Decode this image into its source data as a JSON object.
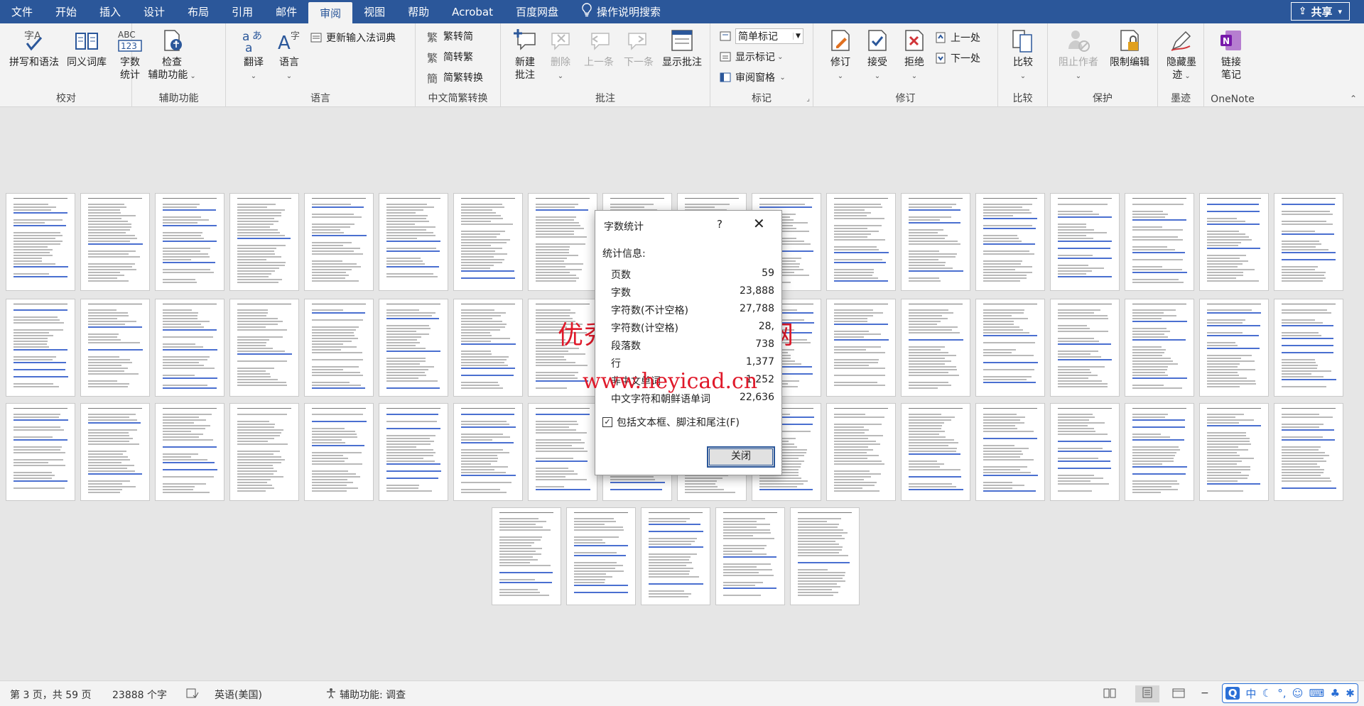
{
  "tabs": [
    "文件",
    "开始",
    "插入",
    "设计",
    "布局",
    "引用",
    "邮件",
    "审阅",
    "视图",
    "帮助",
    "Acrobat",
    "百度网盘"
  ],
  "active_tab": "审阅",
  "tell_me": "操作说明搜索",
  "share": "共享",
  "ribbon": {
    "proofing": {
      "label": "校对",
      "spelling": "拼写和语法",
      "thesaurus": "同义词库",
      "wordcount_line1": "字数",
      "wordcount_line2": "统计",
      "wordcount_icon_text": "ABC",
      "wordcount_icon_num": "123"
    },
    "accessibility": {
      "label": "辅助功能",
      "check_line1": "检查",
      "check_line2": "辅助功能"
    },
    "language": {
      "label": "语言",
      "translate": "翻译",
      "language": "语言",
      "update_ime": "更新输入法词典"
    },
    "chinese_conversion": {
      "label": "中文简繁转换",
      "to_simplified": "繁转简",
      "to_traditional": "简转繁",
      "convert": "简繁转换"
    },
    "comments": {
      "label": "批注",
      "new_line1": "新建",
      "new_line2": "批注",
      "delete": "删除",
      "previous": "上一条",
      "next": "下一条",
      "show": "显示批注"
    },
    "tracking": {
      "label": "标记",
      "markup_combo": "简单标记",
      "show_markup": "显示标记",
      "review_pane": "审阅窗格"
    },
    "changes": {
      "label": "修订",
      "track": "修订",
      "accept": "接受",
      "reject": "拒绝",
      "previous": "上一处",
      "next": "下一处"
    },
    "compare": {
      "label": "比较",
      "compare": "比较"
    },
    "protect": {
      "label": "保护",
      "block_authors": "阻止作者",
      "restrict": "限制编辑"
    },
    "ink": {
      "label": "墨迹",
      "hide_line1": "隐藏墨",
      "hide_line2": "迹"
    },
    "onenote": {
      "label": "OneNote",
      "linked_line1": "链接",
      "linked_line2": "笔记"
    }
  },
  "dialog": {
    "title": "字数统计",
    "help": "?",
    "close_x": "✕",
    "section": "统计信息:",
    "stats": [
      {
        "label": "页数",
        "value": "59"
      },
      {
        "label": "字数",
        "value": "23,888"
      },
      {
        "label": "字符数(不计空格)",
        "value": "27,788"
      },
      {
        "label": "字符数(计空格)",
        "value": "28,"
      },
      {
        "label": "段落数",
        "value": "738"
      },
      {
        "label": "行",
        "value": "1,377"
      },
      {
        "label": "非中文单词",
        "value": "1,252"
      },
      {
        "label": "中文字符和朝鲜语单词",
        "value": "22,636"
      }
    ],
    "include_checkbox": "包括文本框、脚注和尾注(F)",
    "include_checked": true,
    "close_button": "关闭"
  },
  "watermark": {
    "line1": "优秀毕业设计资源网",
    "line2": "www.heyicad.cn",
    "color": "#e0192a"
  },
  "status": {
    "page": "第 3 页，共 59 页",
    "words": "23888 个字",
    "language": "英语(美国)",
    "accessibility": "辅助功能: 调查"
  },
  "ime": {
    "mode": "中"
  },
  "colors": {
    "accent": "#2b579a",
    "ribbon_bg": "#f3f3f3",
    "doc_bg": "#e6e6e6"
  },
  "document": {
    "thumbnail_page_count": 59
  }
}
